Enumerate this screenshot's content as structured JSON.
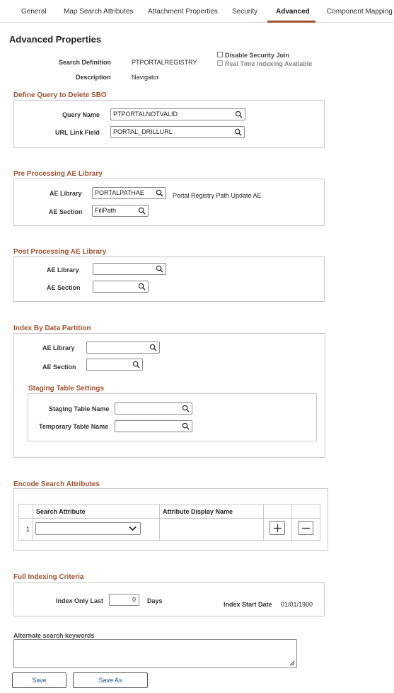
{
  "tabs": [
    {
      "label": "General"
    },
    {
      "label": "Map Search Attributes"
    },
    {
      "label": "Attachment Properties"
    },
    {
      "label": "Security"
    },
    {
      "label": "Advanced"
    },
    {
      "label": "Component Mapping"
    }
  ],
  "page_title": "Advanced Properties",
  "header": {
    "search_definition_label": "Search Definition",
    "search_definition_value": "PTPORTALREGISTRY",
    "description_label": "Description",
    "description_value": "Navigator",
    "disable_security_join": "Disable Security Join",
    "real_time_indexing": "Real Time Indexing Available"
  },
  "delete_sbo": {
    "title": "Define Query to Delete SBO",
    "query_name_label": "Query Name",
    "query_name_value": "PTPORTALNOTVALID",
    "url_link_label": "URL Link Field",
    "url_link_value": "PORTAL_DRILLURL"
  },
  "pre_processing": {
    "title": "Pre Processing AE Library",
    "ae_library_label": "AE Library",
    "ae_library_value": "PORTALPATHAE",
    "ae_library_desc": "Portal Registry Path Update AE",
    "ae_section_label": "AE Section",
    "ae_section_value": "FillPath"
  },
  "post_processing": {
    "title": "Post Processing AE Library",
    "ae_library_label": "AE Library",
    "ae_library_value": "",
    "ae_section_label": "AE Section",
    "ae_section_value": ""
  },
  "partition": {
    "title": "Index By Data Partition",
    "ae_library_label": "AE Library",
    "ae_library_value": "",
    "ae_section_label": "AE Section",
    "ae_section_value": "",
    "staging": {
      "title": "Staging Table Settings",
      "staging_label": "Staging Table Name",
      "staging_value": "",
      "temp_label": "Temporary Table Name",
      "temp_value": ""
    }
  },
  "encode": {
    "title": "Encode Search Attributes",
    "col_search_attribute": "Search Attribute",
    "col_display_name": "Attribute Display Name",
    "rows": [
      {
        "num": "1",
        "search_attribute": "",
        "display_name": ""
      }
    ]
  },
  "full_indexing": {
    "title": "Full Indexing Criteria",
    "index_only_last_label": "Index Only Last",
    "index_only_last_value": "0",
    "days_label": "Days",
    "start_date_label": "Index Start Date",
    "start_date_value": "01/01/1900"
  },
  "keywords": {
    "label": "Alternate search keywords",
    "value": ""
  },
  "buttons": {
    "save": "Save",
    "save_as": "Save As"
  },
  "colors": {
    "accent": "#a0522d",
    "link": "#1a4f8c"
  }
}
